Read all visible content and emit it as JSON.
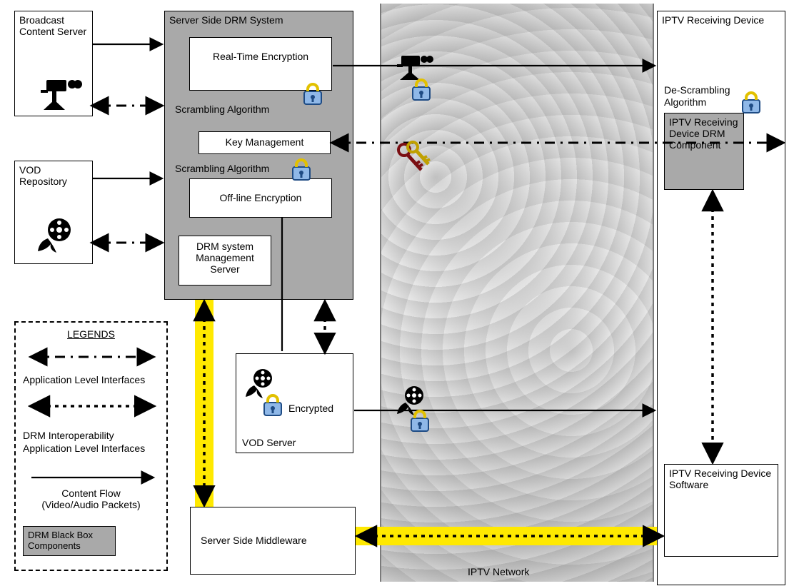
{
  "boxes": {
    "broadcast": "Broadcast Content Server",
    "vod_repo": "VOD Repository",
    "server_side_drm_title": "Server Side DRM System",
    "realtime_enc": "Real-Time Encryption",
    "scrambling1": "Scrambling Algorithm",
    "key_mgmt": "Key Management",
    "scrambling2": "Scrambling Algorithm",
    "offline_enc": "Off-line Encryption",
    "drm_mgmt_server": "DRM system Management Server",
    "vod_server_title": "VOD Server",
    "vod_encrypted": "Encrypted",
    "server_middleware": "Server Side Middleware",
    "iptv_device": "IPTV Receiving Device",
    "descrambling": "De-Scrambling Algorithm",
    "iptv_drm_component": "IPTV Receiving Device DRM Component",
    "iptv_software": "IPTV Receiving Device Software",
    "iptv_network": "IPTV Network"
  },
  "legend": {
    "title": "LEGENDS",
    "app_level": "Application Level Interfaces",
    "interop": "DRM Interoperability Application Level Interfaces",
    "content_flow_1": "Content Flow",
    "content_flow_2": "(Video/Audio Packets)",
    "blackbox": "DRM Black Box Components"
  }
}
